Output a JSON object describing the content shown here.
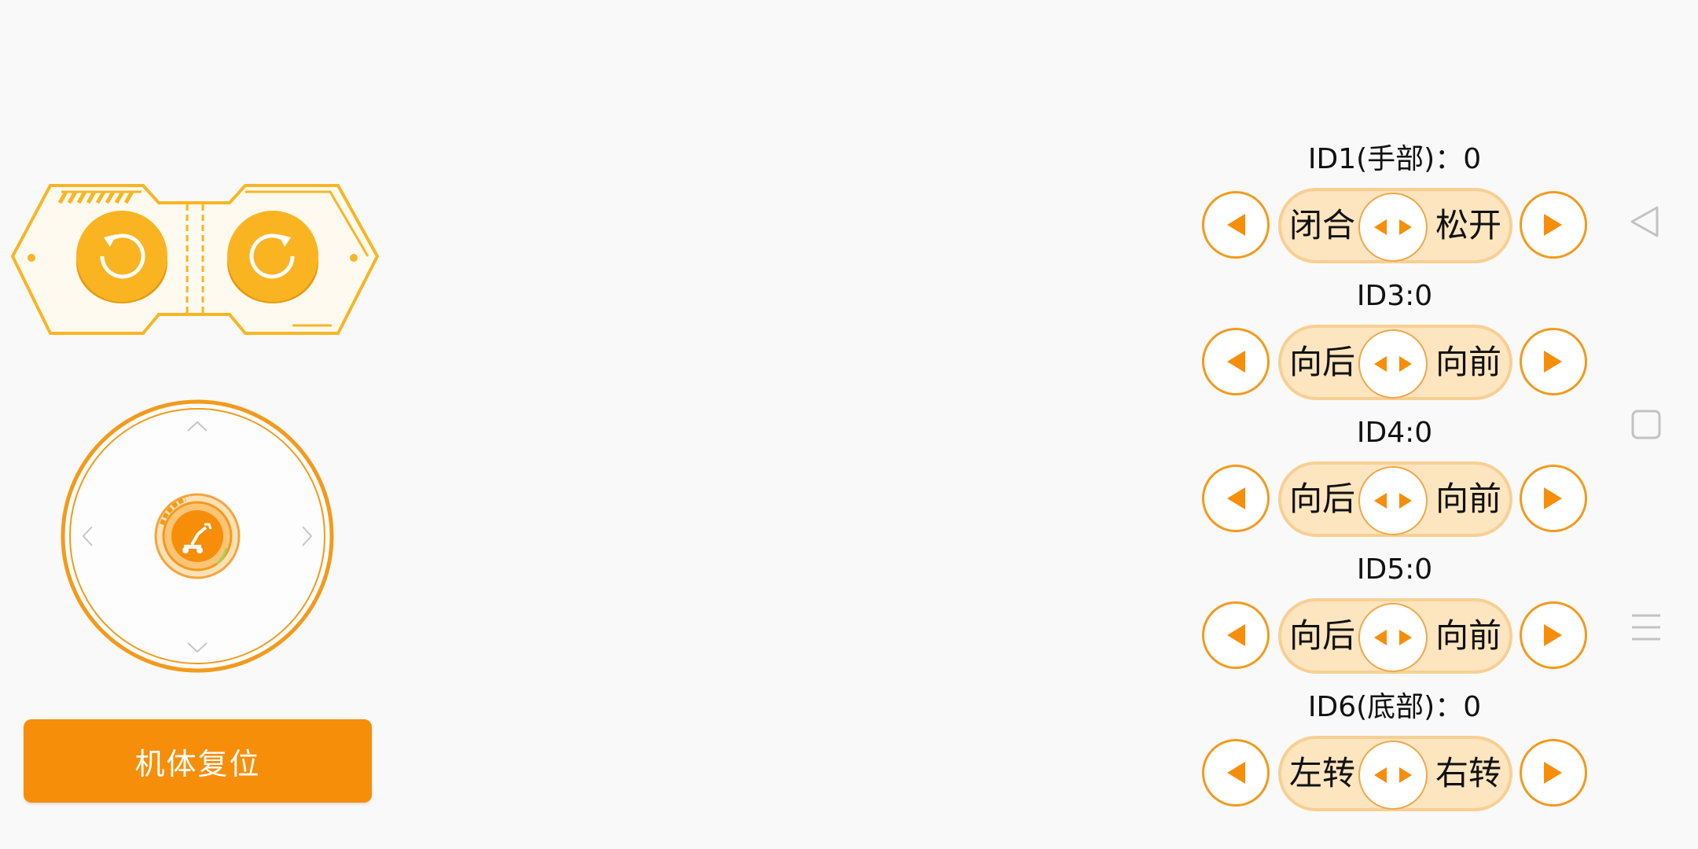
{
  "colors": {
    "accent": "#f78e0a",
    "accent_light": "#fde5bf",
    "accent_border": "#f39a1c",
    "nav_icon": "#c2c2c2"
  },
  "rotate_panel": {
    "left_icon": "rotate-counterclockwise-icon",
    "right_icon": "rotate-clockwise-icon"
  },
  "joystick": {
    "center_icon": "robot-arm-icon"
  },
  "reset": {
    "label": "机体复位"
  },
  "servos": [
    {
      "label": "ID1(手部)：0",
      "left_text": "闭合",
      "right_text": "松开"
    },
    {
      "label": "ID3:0",
      "left_text": "向后",
      "right_text": "向前"
    },
    {
      "label": "ID4:0",
      "left_text": "向后",
      "right_text": "向前"
    },
    {
      "label": "ID5:0",
      "left_text": "向后",
      "right_text": "向前"
    },
    {
      "label": "ID6(底部)：0",
      "left_text": "左转",
      "right_text": "右转"
    }
  ],
  "navbar": {
    "back_icon": "back-triangle-icon",
    "home_icon": "home-square-icon",
    "menu_icon": "menu-lines-icon"
  }
}
